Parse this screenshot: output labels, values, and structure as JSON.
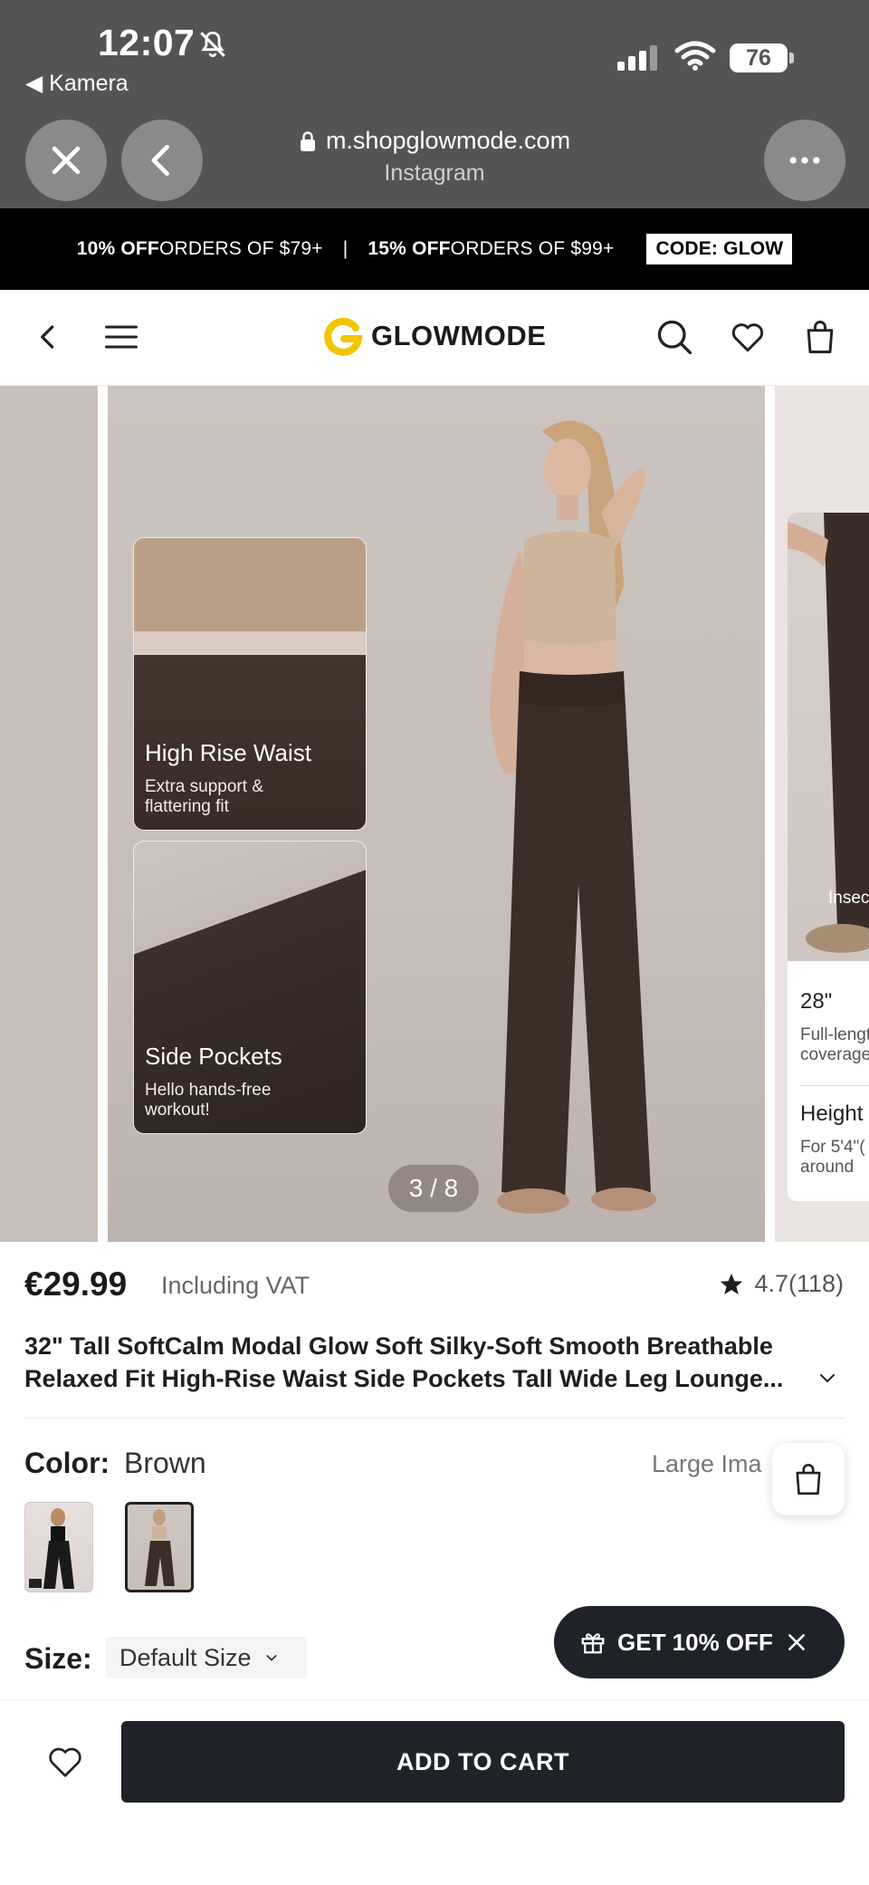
{
  "status_bar": {
    "time": "12:07",
    "back_app": "◀ Kamera",
    "battery": "76"
  },
  "browser": {
    "url": "m.shopglowmode.com",
    "source": "Instagram"
  },
  "promo_banner": {
    "offer1_strong": "10% OFF",
    "offer1_rest": " ORDERS OF $79+",
    "separator": "|",
    "offer2_strong": "15% OFF",
    "offer2_rest": " ORDERS OF $99+",
    "code": "CODE: GLOW"
  },
  "header": {
    "brand": "GLOWMODE",
    "brand_color": "#f2c500"
  },
  "gallery": {
    "counter": "3 / 8",
    "cards": [
      {
        "title": "High Rise Waist",
        "subtitle": "Extra support & flattering fit"
      },
      {
        "title": "Side Pockets",
        "subtitle": "Hello hands-free workout!"
      }
    ],
    "next_slide": {
      "inseam_label": "Insec",
      "length": "28\"",
      "length_desc_1": "Full-lengt",
      "length_desc_2": "coverage",
      "height_label": "Height",
      "height_desc_1": "For 5'4\"(",
      "height_desc_2": "around"
    }
  },
  "product": {
    "price": "€29.99",
    "vat_note": "Including VAT",
    "rating": "4.7(118)",
    "title": "32\" Tall SoftCalm Modal Glow Soft Silky-Soft Smooth Breathable Relaxed Fit High-Rise Waist Side Pockets Tall Wide Leg Lounge...",
    "color_label": "Color:",
    "color_value": "Brown",
    "large_image_link": "Large Ima",
    "size_label": "Size:",
    "size_value": "Default Size"
  },
  "discount_pill": {
    "label": "GET 10% OFF"
  },
  "bottom_bar": {
    "add_to_cart": "ADD TO CART"
  }
}
